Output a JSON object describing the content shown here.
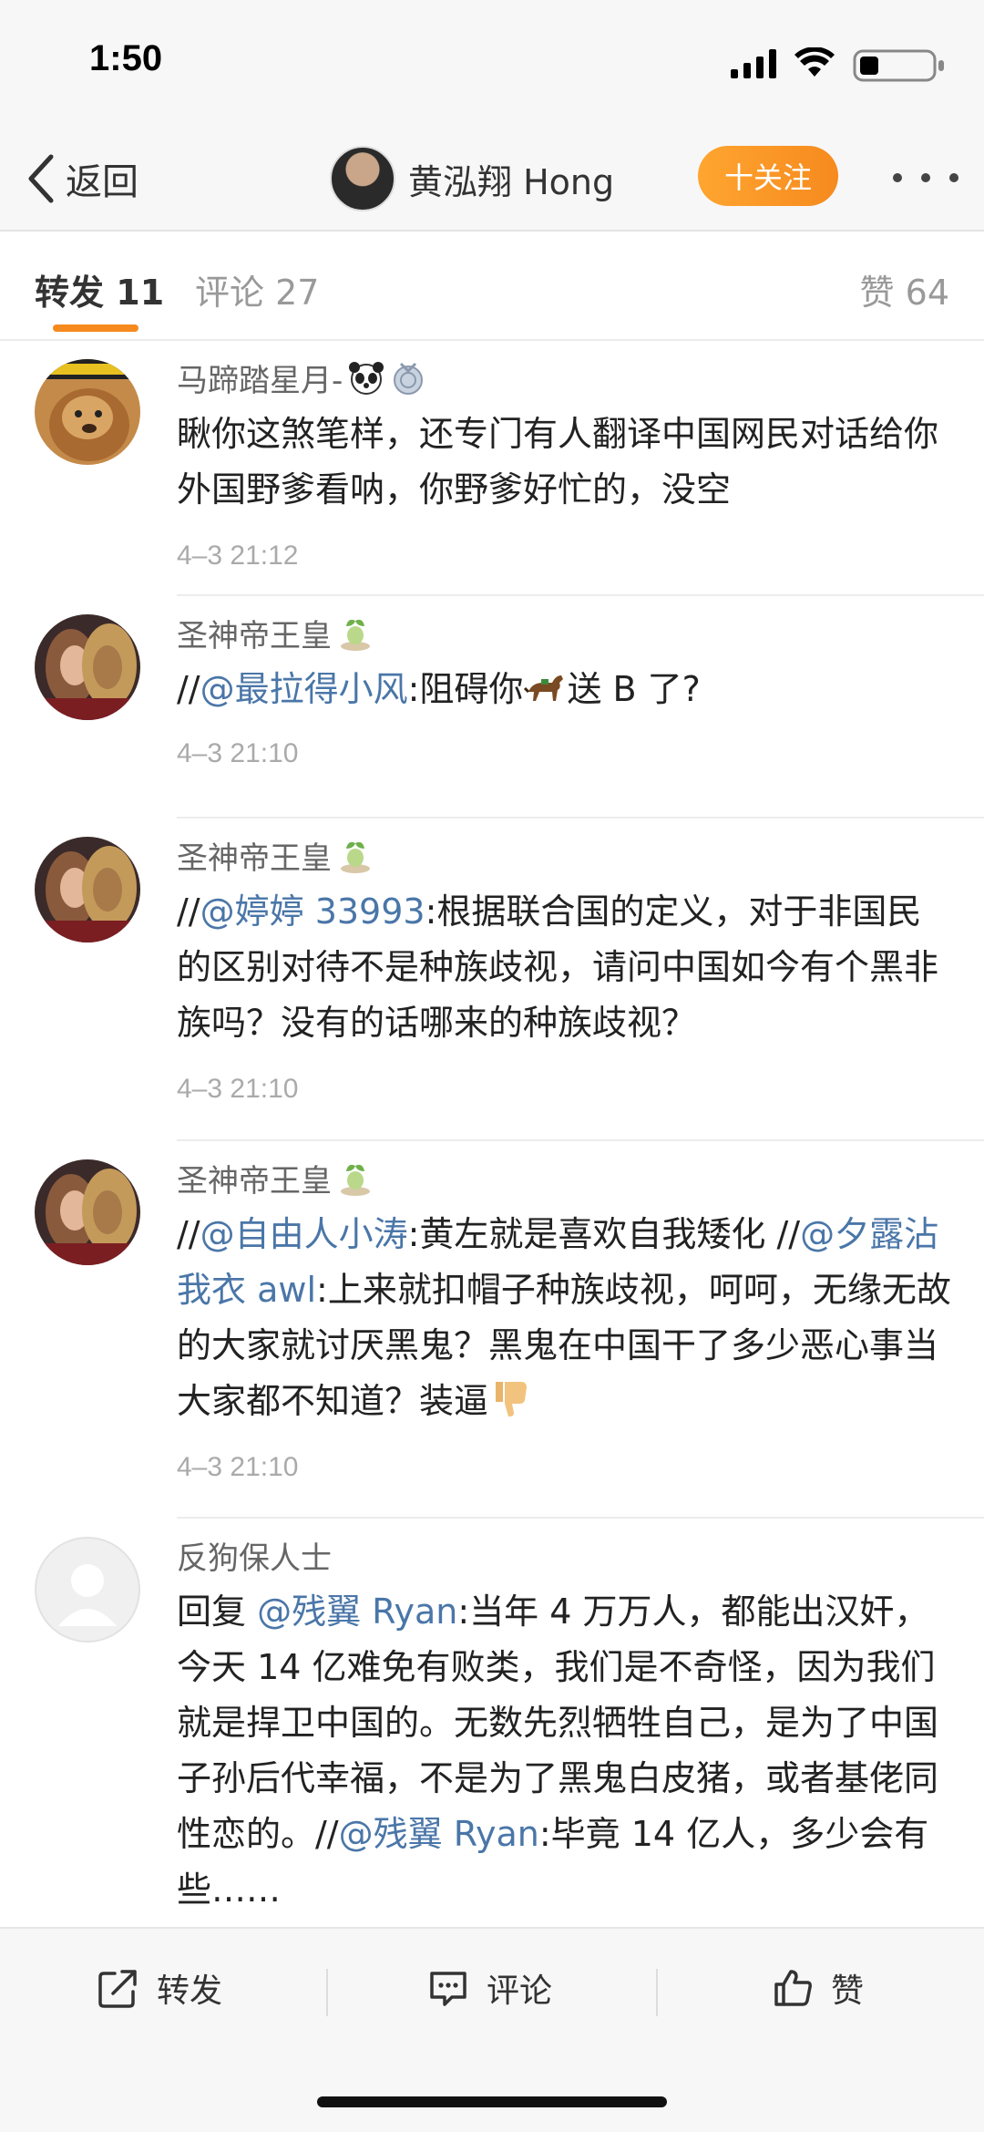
{
  "status_bar": {
    "time": "1:50"
  },
  "nav": {
    "back_label": "返回",
    "user_name": "黄泓翔 Hong",
    "follow_label": "十关注"
  },
  "tabs": [
    {
      "label": "转发",
      "count": "11"
    },
    {
      "label": "评论",
      "count": "27"
    },
    {
      "label": "赞",
      "count": "64"
    }
  ],
  "comments": [
    {
      "user": "马蹄踏星月-",
      "badges": [
        "panda-icon",
        "medal-icon"
      ],
      "text": "瞅你这煞笔样，还专门有人翻译中国网民对话给你外国野爹看呐，你野爹好忙的，没空",
      "time": "4–3 21:12"
    },
    {
      "user": "圣神帝王皇",
      "badges": [
        "plant-badge-icon"
      ],
      "prefix": "//",
      "mention": "@最拉得小风",
      "text_a": ":阻碍你",
      "emoji": "horse-emoji",
      "text_b": "送 B 了?",
      "time": "4–3 21:10"
    },
    {
      "user": "圣神帝王皇",
      "badges": [
        "plant-badge-icon"
      ],
      "prefix": "//",
      "mention": "@婷婷 33993",
      "text": ":根据联合国的定义，对于非国民的区别对待不是种族歧视，请问中国如今有个黑非族吗？没有的话哪来的种族歧视？",
      "time": "4–3 21:10"
    },
    {
      "user": "圣神帝王皇",
      "badges": [
        "plant-badge-icon"
      ],
      "prefix": "//",
      "mention": "@自由人小涛",
      "text_a": ":黄左就是喜欢自我矮化 //",
      "mention2": "@夕露沾我衣 awl",
      "text_b": ":上来就扣帽子种族歧视，呵呵，无缘无故的大家就讨厌黑鬼？黑鬼在中国干了多少恶心事当大家都不知道？装逼",
      "emoji": "thumbs-down-emoji",
      "time": "4–3 21:10"
    },
    {
      "user": "反狗保人士",
      "prefix": "回复 ",
      "mention": "@残翼 Ryan",
      "text_a": ":当年 4 万万人，都能出汉奸，今天 14 亿难免有败类，我们是不奇怪，因为我们就是捍卫中国的。无数先烈牺牲自己，是为了中国子孙后代幸福，不是为了黑鬼白皮猪，或者基佬同性恋的。//",
      "mention2": "@残翼 Ryan",
      "text_b": ":毕竟 14 亿人，多少会有些……"
    }
  ],
  "actions": [
    {
      "label": "转发",
      "icon": "share-icon"
    },
    {
      "label": "评论",
      "icon": "comment-icon"
    },
    {
      "label": "赞",
      "icon": "thumbs-up-icon"
    }
  ],
  "colors": {
    "accent": "#f68a1e",
    "mention": "#4a76a8",
    "bar_bg": "#f7f7f7"
  }
}
